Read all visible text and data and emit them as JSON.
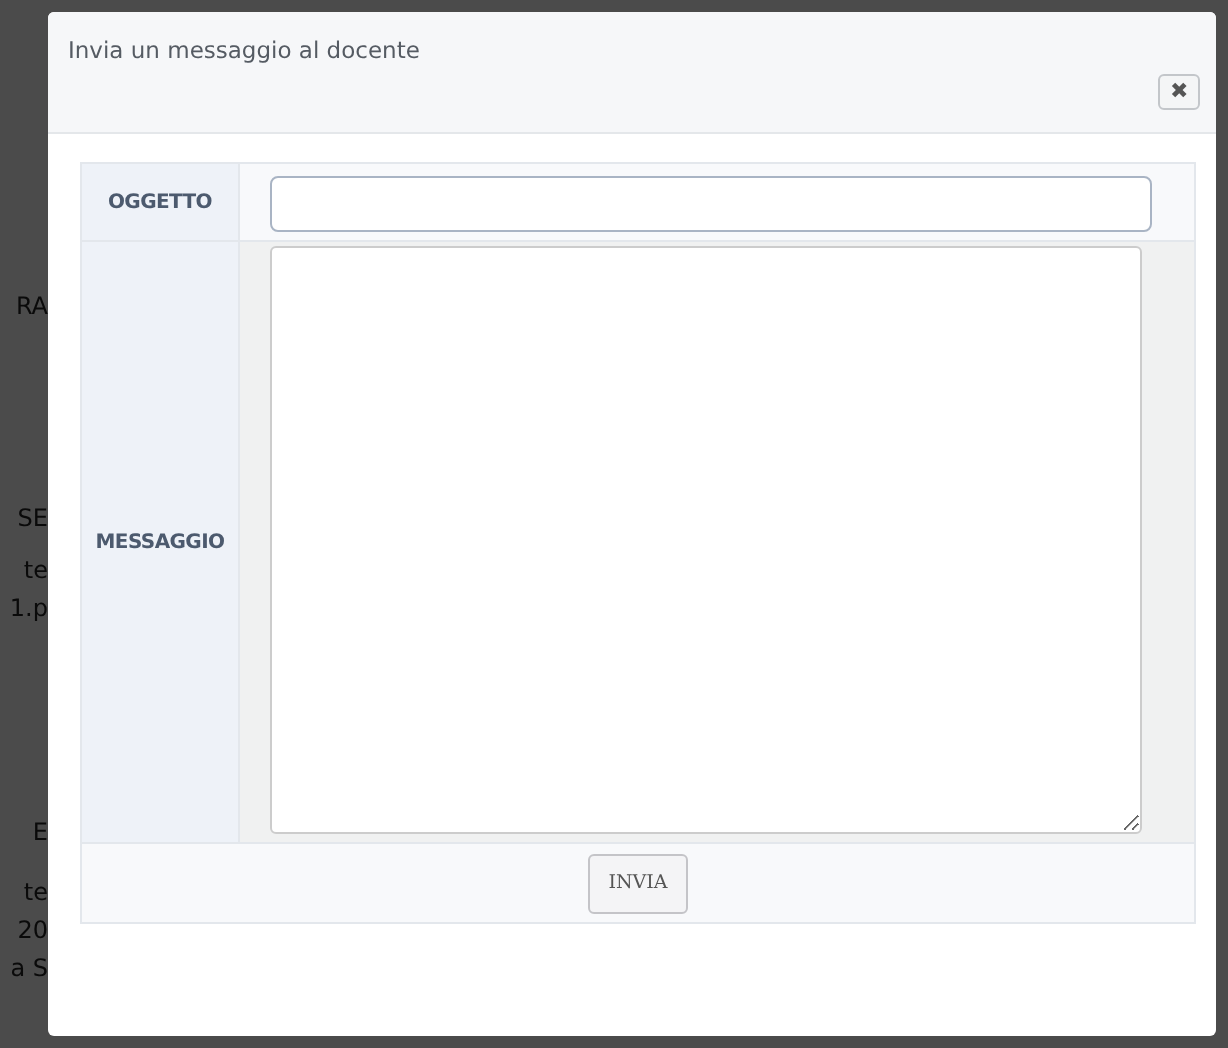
{
  "background_fragments": [
    "RA",
    "SE",
    "te",
    "1.p",
    "E",
    "te",
    "20",
    "a S"
  ],
  "dialog": {
    "title": "Invia un messaggio al docente",
    "close_icon": "✖",
    "fields": [
      {
        "kind": "input",
        "label": "OGGETTO"
      },
      {
        "kind": "textarea",
        "label": "MESSAGGIO"
      }
    ],
    "submit_button": "INVIA"
  }
}
